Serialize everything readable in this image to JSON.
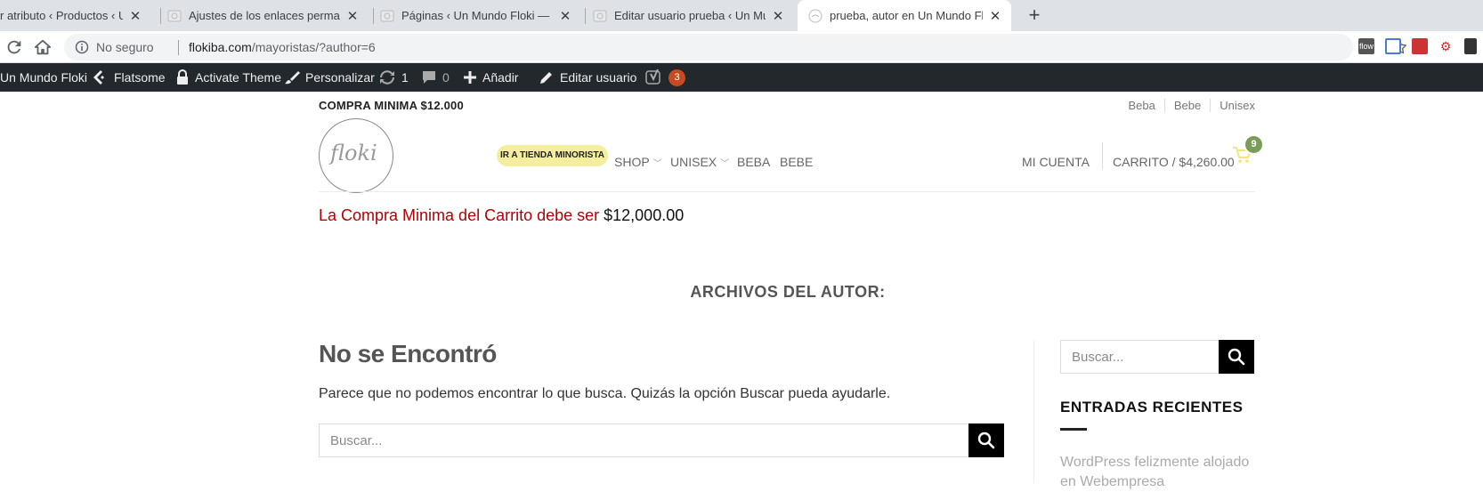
{
  "tabs": [
    {
      "title": "r atributo ‹ Productos ‹ Un Mundo",
      "close": "✕"
    },
    {
      "title": "Ajustes de los enlaces permanentes",
      "close": "✕"
    },
    {
      "title": "Páginas ‹ Un Mundo Floki — Word",
      "close": "✕"
    },
    {
      "title": "Editar usuario prueba ‹ Un Mundo",
      "close": "✕"
    },
    {
      "title": "prueba, autor en Un Mundo Floki",
      "close": "✕"
    }
  ],
  "new_tab": "+",
  "omnibox": {
    "security": "No seguro",
    "host": "flokiba.com",
    "path": "/mayoristas/?author=6"
  },
  "extensions": [
    "flow",
    "",
    "",
    ""
  ],
  "adminbar": {
    "site": "Un Mundo Floki",
    "flatsome": "Flatsome",
    "activate": "Activate Theme",
    "customize": "Personalizar",
    "updates": "1",
    "comments": "0",
    "add": "Añadir",
    "edit_user": "Editar usuario",
    "yoast_count": "3"
  },
  "topbar": {
    "min_purchase": "COMPRA MINIMA $12.000",
    "links": [
      "Beba",
      "Bebe",
      "Unisex"
    ]
  },
  "logo_text": "floki",
  "nav": {
    "retail": "IR A TIENDA MINORISTA",
    "shop": "SHOP",
    "unisex": "UNISEX",
    "beba": "BEBA",
    "bebe": "BEBE",
    "account": "MI CUENTA",
    "cart": "CARRITO / $4,260.00",
    "cart_count": "9"
  },
  "notice": {
    "text": "La Compra Minima del Carrito debe ser ",
    "amount": "$12,000.00"
  },
  "archive_title": "ARCHIVOS DEL AUTOR:",
  "not_found": {
    "title": "No se Encontró",
    "text": "Parece que no podemos encontrar lo que busca. Quizás la opción Buscar pueda ayudarle.",
    "search_placeholder": "Buscar..."
  },
  "sidebar": {
    "search_placeholder": "Buscar...",
    "recent_title": "ENTRADAS RECIENTES",
    "recent_post": "WordPress felizmente alojado en Webempresa"
  }
}
